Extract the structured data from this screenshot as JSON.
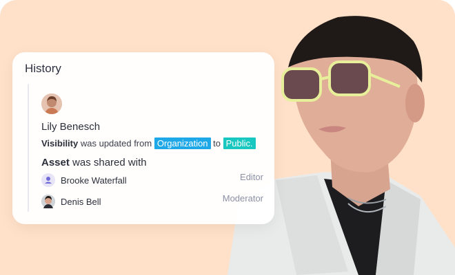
{
  "card": {
    "title": "History",
    "author": "Lily Benesch",
    "change": {
      "field": "Visibility",
      "text_before": "was updated from",
      "from_value": "Organization",
      "connector": "to",
      "to_value": "Public."
    },
    "shared": {
      "subject": "Asset",
      "text": "was shared with"
    },
    "users": [
      {
        "name": "Brooke Waterfall",
        "role": "Editor",
        "avatar_icon": "user-icon"
      },
      {
        "name": "Denis Bell",
        "role": "Moderator",
        "avatar_icon": "photo-avatar"
      }
    ]
  },
  "colors": {
    "background": "#ffe0c8",
    "tag_organization": "#1fa8e8",
    "tag_public": "#18c7bf"
  }
}
